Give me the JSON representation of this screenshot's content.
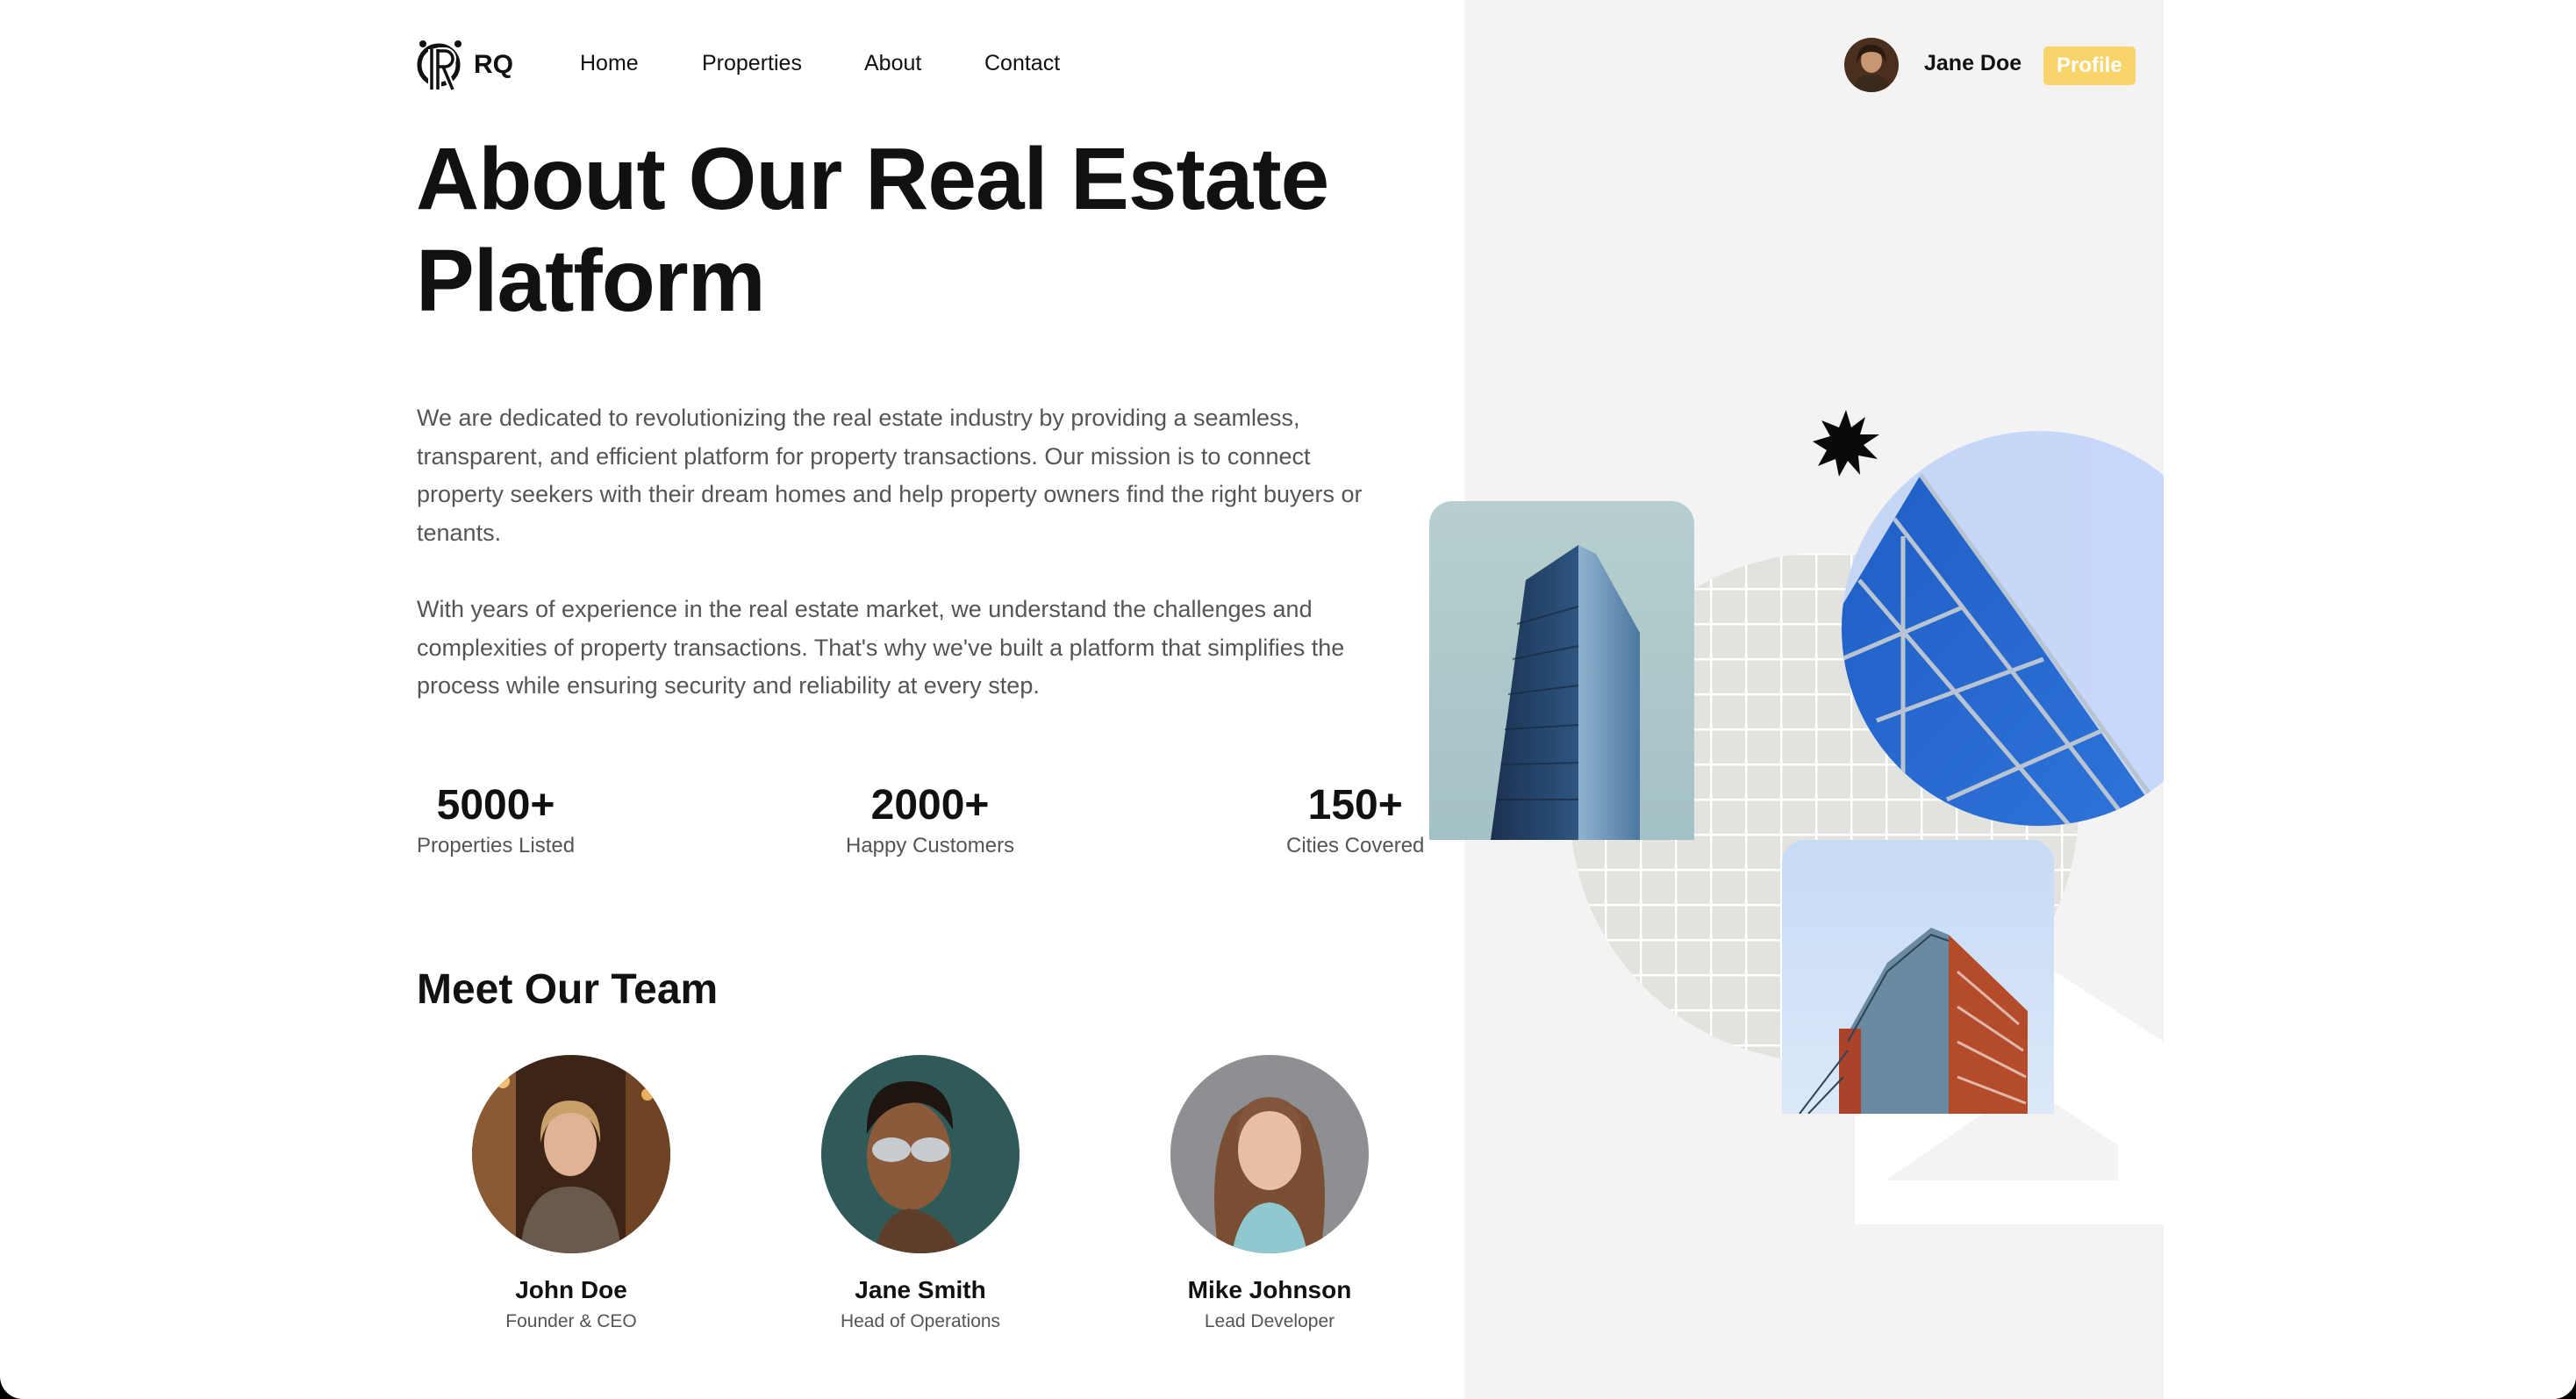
{
  "nav": {
    "logo_text": "RQ",
    "links": [
      "Home",
      "Properties",
      "About",
      "Contact"
    ]
  },
  "user": {
    "name": "Jane Doe",
    "profile_label": "Profile"
  },
  "hero": {
    "title": "About Our Real Estate Platform",
    "paragraph_1": "We are dedicated to revolutionizing the real estate industry by providing a seamless, transparent, and efficient platform for property transactions. Our mission is to connect property seekers with their dream homes and help property owners find the right buyers or tenants.",
    "paragraph_2": "With years of experience in the real estate market, we understand the challenges and complexities of property transactions. That's why we've built a platform that simplifies the process while ensuring security and reliability at every step."
  },
  "stats": [
    {
      "value": "5000+",
      "label": "Properties Listed"
    },
    {
      "value": "2000+",
      "label": "Happy Customers"
    },
    {
      "value": "150+",
      "label": "Cities Covered"
    }
  ],
  "team": {
    "heading": "Meet Our Team",
    "members": [
      {
        "name": "John Doe",
        "role": "Founder & CEO"
      },
      {
        "name": "Jane Smith",
        "role": "Head of Operations"
      },
      {
        "name": "Mike Johnson",
        "role": "Lead Developer"
      }
    ]
  },
  "colors": {
    "accent": "#f9d46b",
    "text": "#111111",
    "muted": "#555555",
    "panel": "#f3f3f3"
  },
  "icons": [
    "rq-logo-icon",
    "starburst-icon",
    "house-outline-icon"
  ]
}
